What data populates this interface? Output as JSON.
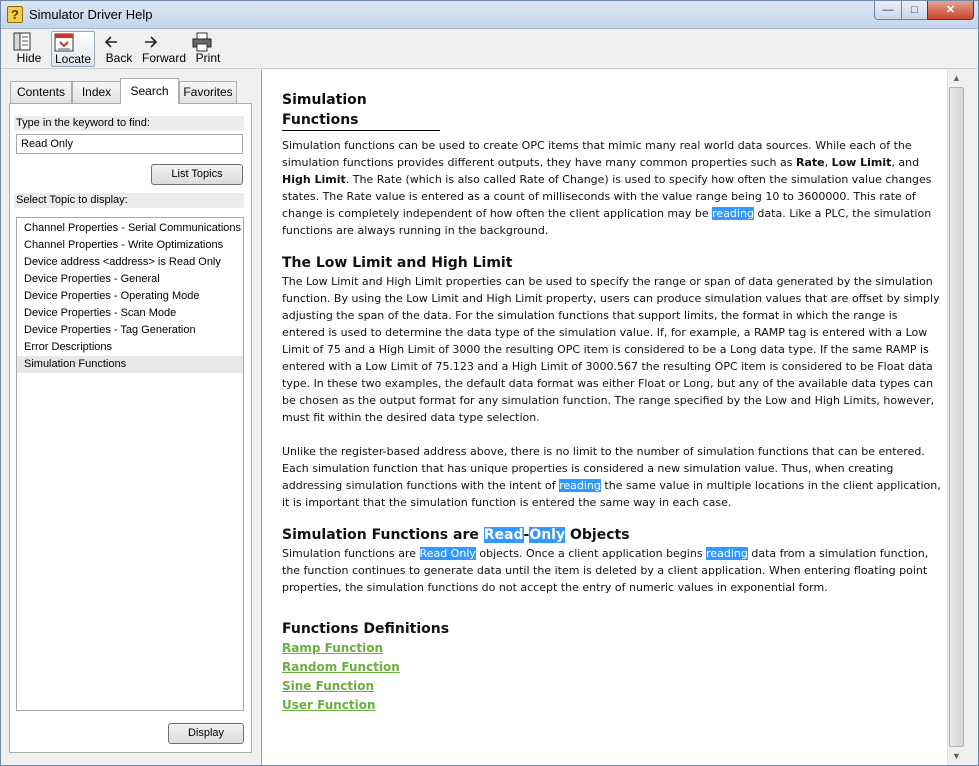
{
  "window": {
    "title": "Simulator Driver Help",
    "controls": {
      "minimize": "—",
      "maximize": "□",
      "close": "✕"
    }
  },
  "toolbar": {
    "hide": "Hide",
    "locate": "Locate",
    "back": "Back",
    "forward": "Forward",
    "print": "Print"
  },
  "nav_tabs": {
    "contents": "Contents",
    "index": "Index",
    "search": "Search",
    "favorites": "Favorites",
    "active": "Search"
  },
  "search": {
    "keyword_label": "Type in the keyword to find:",
    "keyword_value": "Read Only",
    "list_topics_button": "List Topics",
    "select_topic_label": "Select Topic to display:",
    "topics": [
      "Channel Properties - Serial Communications",
      "Channel Properties - Write Optimizations",
      "Device address <address> is Read Only",
      "Device Properties - General",
      "Device Properties - Operating Mode",
      "Device Properties - Scan Mode",
      "Device Properties - Tag Generation",
      "Error Descriptions",
      "Simulation Functions"
    ],
    "selected_topic": "Simulation Functions",
    "display_button": "Display"
  },
  "article": {
    "title": "Simulation Functions",
    "intro": {
      "p1": "Simulation functions can be used to create OPC items that mimic many real world data sources. While each of the simulation functions provides different outputs, they have many common properties such as ",
      "rate": "Rate",
      "sep1": ", ",
      "low_limit": "Low Limit",
      "sep2": ", and ",
      "high_limit": "High Limit",
      "p2": ". The Rate (which is also called Rate of Change) is used to specify how often the simulation value changes states. The Rate value is entered as a count of milliseconds with the value range being 10 to 3600000. This rate of change is completely independent of how often the client application may be ",
      "hl_reading": "reading",
      "p3": " data. Like a PLC, the simulation functions are always running in the background."
    },
    "limits_heading": "The Low Limit and High Limit",
    "limits_text": "The Low Limit and High Limit properties can be used to specify the range or span of data generated by the simulation function. By using the Low Limit and High Limit property, users can produce simulation values that are offset by simply adjusting the span of the data. For the simulation functions that support limits, the format in which the range is entered is used to determine the data type of the simulation value. If, for example, a RAMP tag is entered with a Low Limit of 75 and a High Limit of 3000 the resulting OPC item is considered to be a Long data type. If the same RAMP is entered with a Low Limit of 75.123 and a High Limit of 3000.567 the resulting OPC item is considered to be Float data type. In these two examples, the default data format was either Float or Long, but any of the available data types can be chosen as the output format for any simulation function. The range specified by the Low and High Limits, however, must fit within the desired data type selection.",
    "register": {
      "p1": "Unlike the register-based address above, there is no limit to the number of simulation functions that can be entered. Each simulation function that has unique properties is considered a new simulation value. Thus, when creating addressing simulation functions with the intent of ",
      "hl_reading": "reading",
      "p2": " the same value in multiple locations in the client application, it is important that the simulation function is entered the same way in each case."
    },
    "readonly_heading": {
      "pre": "Simulation Functions are ",
      "hl_read": "Read",
      "dash": "-",
      "hl_only": "Only",
      "post": " Objects"
    },
    "readonly": {
      "p1": "Simulation functions are ",
      "hl_read_only": "Read Only",
      "p2": " objects. Once a client application begins ",
      "hl_reading": "reading",
      "p3": " data from a simulation function, the function continues to generate data until the item is deleted by a client application. When entering floating point properties, the simulation functions do not accept the entry of numeric values in exponential form."
    },
    "definitions_heading": "Functions Definitions",
    "definitions": [
      "Ramp Function",
      "Random Function",
      "Sine Function",
      "User Function"
    ]
  },
  "colors": {
    "highlight": "#3399ff",
    "link": "#6ab03c"
  }
}
